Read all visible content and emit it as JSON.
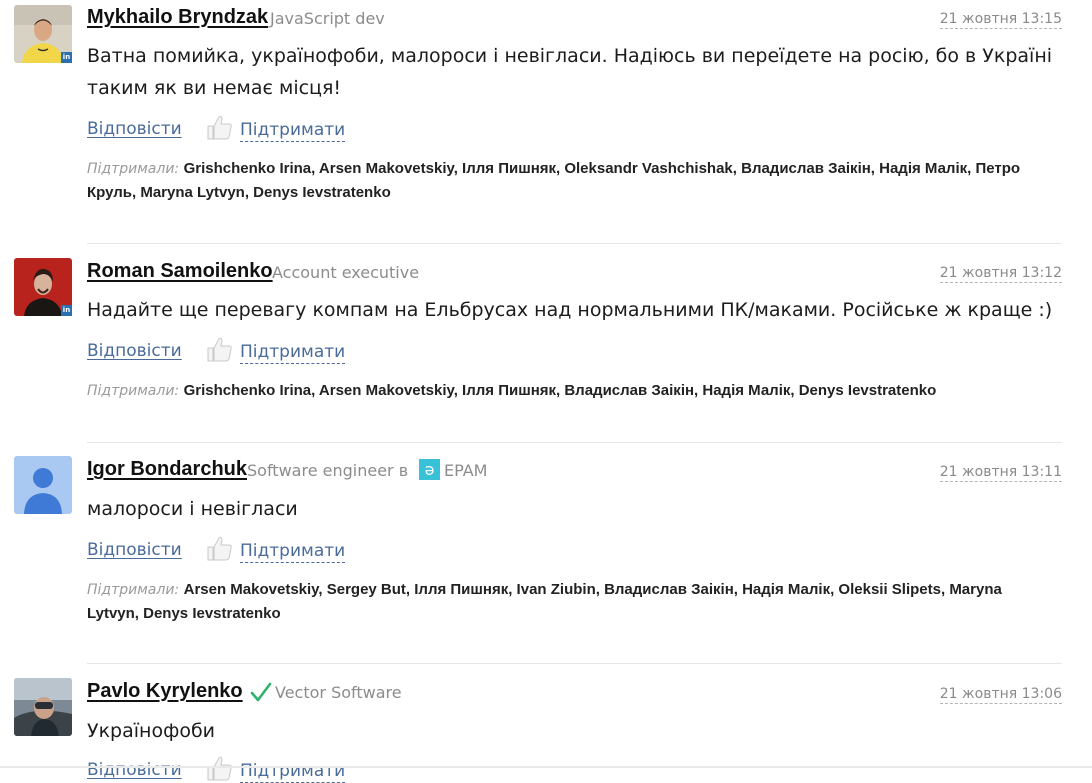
{
  "comments": [
    {
      "author": "Mykhailo Bryndzak",
      "role": "JavaScript dev",
      "date": "21 жовтня 13:15",
      "text": "Ватна помийка, українофоби, малороси і невігласи. Надіюсь ви переїдете на росію, бо в Україні таким як ви немає місця!",
      "reply_label": "Відповісти",
      "support_label": "Підтримати",
      "supported_label": "Підтримали:",
      "supporters": "Grishchenko Irina, Arsen Makovetskiy, Ілля Пишняк, Oleksandr Vashchishak, Владислав Заікін, Надія Малік, Петро Круль, Maryna Lytvyn, Denys Ievstratenko",
      "linkedin": "in"
    },
    {
      "author": "Roman Samoilenko",
      "role": "Account executive",
      "date": "21 жовтня 13:12",
      "text": "Надайте ще перевагу компам на Ельбрусах над нормальними ПК/маками. Російське ж краще :)",
      "reply_label": "Відповісти",
      "support_label": "Підтримати",
      "supported_label": "Підтримали:",
      "supporters": "Grishchenko Irina, Arsen Makovetskiy, Ілля Пишняк, Владислав Заікін, Надія Малік, Denys Ievstratenko",
      "linkedin": "in"
    },
    {
      "author": "Igor Bondarchuk",
      "role": "Software engineer в",
      "company_logo": "ǝ",
      "company": "EPAM",
      "date": "21 жовтня 13:11",
      "text": "малороси і невігласи",
      "reply_label": "Відповісти",
      "support_label": "Підтримати",
      "supported_label": "Підтримали:",
      "supporters": "Arsen Makovetskiy, Sergey But, Ілля Пишняк, Ivan Ziubin, Владислав Заікін, Надія Малік, Oleksii Slipets, Maryna Lytvyn, Denys Ievstratenko"
    },
    {
      "author": "Pavlo Kyrylenko",
      "company": "Vector Software",
      "date": "21 жовтня 13:06",
      "text": "Українофоби",
      "reply_label": "Відповісти",
      "support_label": "Підтримати"
    }
  ],
  "icons": {
    "thumb": "thumbs-up-icon",
    "verified": "checkmark-icon",
    "default_avatar": "user-silhouette-icon"
  },
  "colors": {
    "link": "#4a6b9a",
    "epam": "#39c2d7",
    "verified": "#2fb36d"
  }
}
